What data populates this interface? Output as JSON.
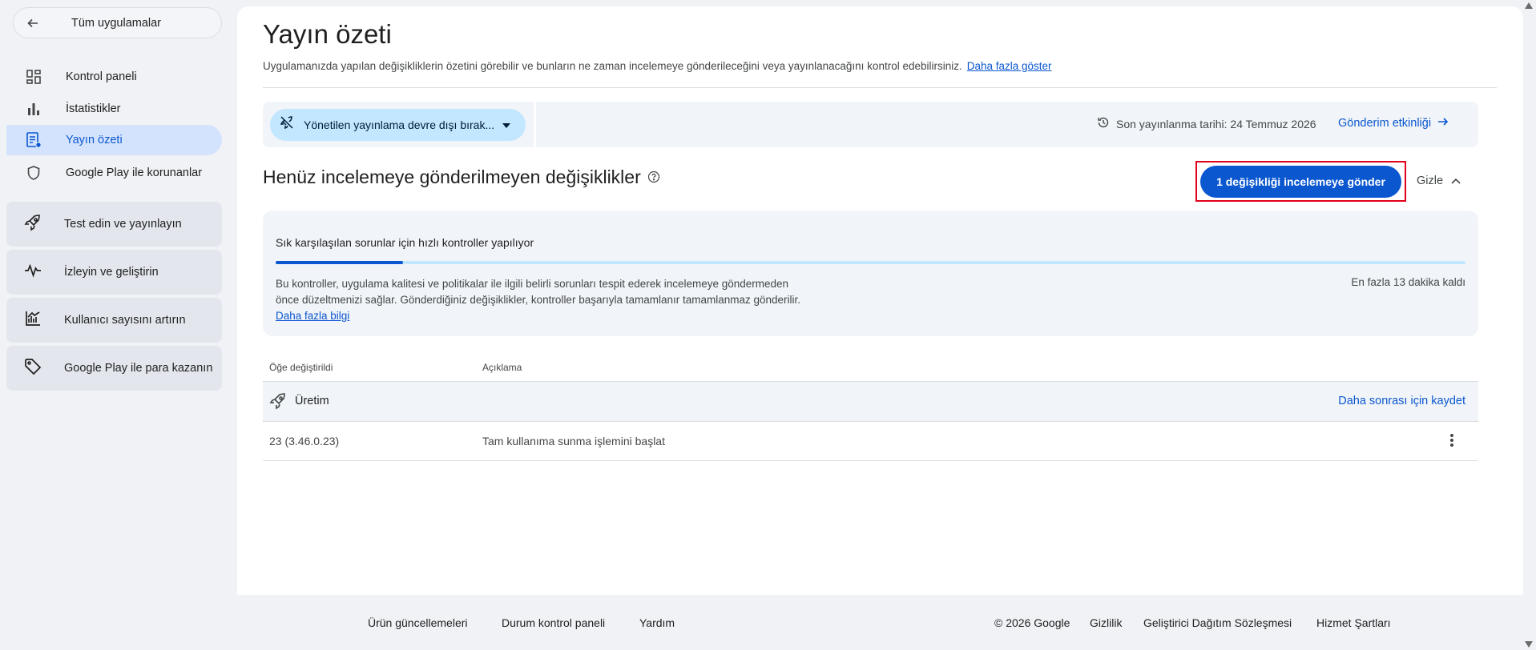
{
  "sidebar": {
    "back_label": "Tüm uygulamalar",
    "items": [
      {
        "label": "Kontrol paneli",
        "icon": "dashboard-icon"
      },
      {
        "label": "İstatistikler",
        "icon": "bar-chart-icon"
      },
      {
        "label": "Yayın özeti",
        "icon": "publishing-overview-icon",
        "active": true
      },
      {
        "label": "Google Play ile korunanlar",
        "icon": "shield-icon"
      }
    ],
    "groups": [
      {
        "label": "Test edin ve yayınlayın",
        "icon": "rocket-icon"
      },
      {
        "label": "İzleyin ve geliştirin",
        "icon": "pulse-icon"
      },
      {
        "label": "Kullanıcı sayısını artırın",
        "icon": "growth-chart-icon"
      },
      {
        "label": "Google Play ile para kazanın",
        "icon": "tag-icon"
      }
    ]
  },
  "header": {
    "title": "Yayın özeti",
    "subtitle": "Uygulamanızda yapılan değişikliklerin özetini görebilir ve bunların ne zaman incelemeye gönderileceğini veya yayınlanacağını kontrol edebilirsiniz.",
    "more_link": "Daha fazla göster"
  },
  "toolbar": {
    "managed_publishing_label": "Yönetilen yayınlama devre dışı bırak...",
    "last_published": "Son yayınlanma tarihi: 24 Temmuz 2026",
    "activity_link": "Gönderim etkinliği"
  },
  "changes": {
    "title": "Henüz incelemeye gönderilmeyen değişiklikler",
    "send_button": "1 değişikliği incelemeye gönder",
    "hide_button": "Gizle"
  },
  "checks": {
    "title": "Sık karşılaşılan sorunlar için hızlı kontroller yapılıyor",
    "progress": 0.107,
    "description": "Bu kontroller, uygulama kalitesi ve politikalar ile ilgili belirli sorunları tespit ederek incelemeye göndermeden önce düzeltmenizi sağlar. Gönderdiğiniz değişiklikler, kontroller başarıyla tamamlanır tamamlanmaz gönderilir.",
    "learn_more": "Daha fazla bilgi",
    "time_left": "En fazla 13 dakika kaldı"
  },
  "table": {
    "headers": [
      "Öğe değiştirildi",
      "Açıklama"
    ],
    "group_label": "Üretim",
    "save_later": "Daha sonrası için kaydet",
    "rows": [
      {
        "item": "23 (3.46.0.23)",
        "description": "Tam kullanıma sunma işlemini başlat"
      }
    ]
  },
  "footer": {
    "product_updates": "Ürün güncellemeleri",
    "status_dashboard": "Durum kontrol paneli",
    "help": "Yardım",
    "copyright": "© 2026 Google",
    "privacy": "Gizlilik",
    "dda": "Geliştirici Dağıtım Sözleşmesi",
    "terms": "Hizmet Şartları"
  },
  "colors": {
    "accent": "#0b57d0",
    "active_nav_bg": "#d3e3fd",
    "chip_bg": "#c2e7ff",
    "highlight_outline": "#e2001a"
  }
}
